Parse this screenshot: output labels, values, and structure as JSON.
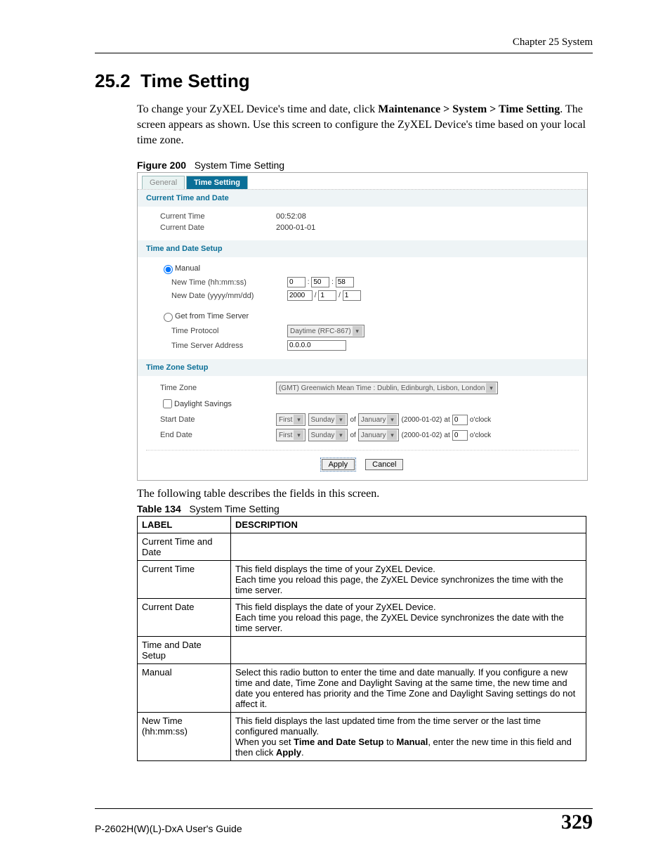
{
  "header": {
    "chapter": "Chapter 25 System"
  },
  "section": {
    "number": "25.2",
    "title": "Time Setting",
    "intro_html": "To change your ZyXEL Device's time and date, click <b>Maintenance > System > Time Setting</b>. The screen appears as shown. Use this screen to configure the ZyXEL Device's time based on your local time zone."
  },
  "figure": {
    "num": "Figure 200",
    "caption": "System Time Setting"
  },
  "ui": {
    "tabs": {
      "inactive": "General",
      "active": "Time Setting"
    },
    "sec1": {
      "title": "Current Time and Date",
      "ctime_label": "Current Time",
      "ctime_val": "00:52:08",
      "cdate_label": "Current Date",
      "cdate_val": "2000-01-01"
    },
    "sec2": {
      "title": "Time and Date Setup",
      "manual_label": "Manual",
      "newtime_label": "New Time (hh:mm:ss)",
      "hh": "0",
      "mm": "50",
      "ss": "58",
      "newdate_label": "New Date (yyyy/mm/dd)",
      "yyyy": "2000",
      "mo": "1",
      "dd": "1",
      "getfrom_label": "Get from Time Server",
      "proto_label": "Time Protocol",
      "proto_val": "Daytime (RFC-867)",
      "addr_label": "Time Server Address",
      "addr_val": "0.0.0.0"
    },
    "sec3": {
      "title": "Time Zone Setup",
      "tz_label": "Time Zone",
      "tz_val": "(GMT) Greenwich Mean Time : Dublin, Edinburgh, Lisbon, London",
      "ds_label": "Daylight Savings",
      "start_label": "Start Date",
      "end_label": "End Date",
      "ordinal": "First",
      "day": "Sunday",
      "of": "of",
      "month": "January",
      "paren": "(2000-01-02)",
      "at": "at",
      "hour": "0",
      "oclock": "o'clock"
    },
    "btns": {
      "apply": "Apply",
      "cancel": "Cancel"
    }
  },
  "after_shot": "The following table describes the fields in this screen.",
  "table": {
    "num": "Table 134",
    "caption": "System Time Setting",
    "head_label": "LABEL",
    "head_desc": "DESCRIPTION",
    "rows": [
      {
        "label": "Current Time and Date",
        "desc": ""
      },
      {
        "label": "Current Time",
        "desc": "This field displays the time of your ZyXEL Device.\nEach time you reload this page, the ZyXEL Device synchronizes the time with the time server."
      },
      {
        "label": "Current Date",
        "desc": "This field displays the date of your ZyXEL Device.\nEach time you reload this page, the ZyXEL Device synchronizes the date with the time server."
      },
      {
        "label": "Time and Date Setup",
        "desc": ""
      },
      {
        "label": "Manual",
        "desc": "Select this radio button to enter the time and date manually. If you configure a new time and date, Time Zone and Daylight Saving at the same time, the new time and date you entered has priority and the Time Zone and Daylight Saving settings do not affect it."
      },
      {
        "label": "New Time\n (hh:mm:ss)",
        "desc_html": "This field displays the last updated time from the time server or the last time configured manually.<br>When you set <b>Time and Date Setup</b> to <b>Manual</b>, enter the new time in this field and then click <b>Apply</b>."
      }
    ]
  },
  "footer": {
    "guide": "P-2602H(W)(L)-DxA User's Guide",
    "page": "329"
  }
}
